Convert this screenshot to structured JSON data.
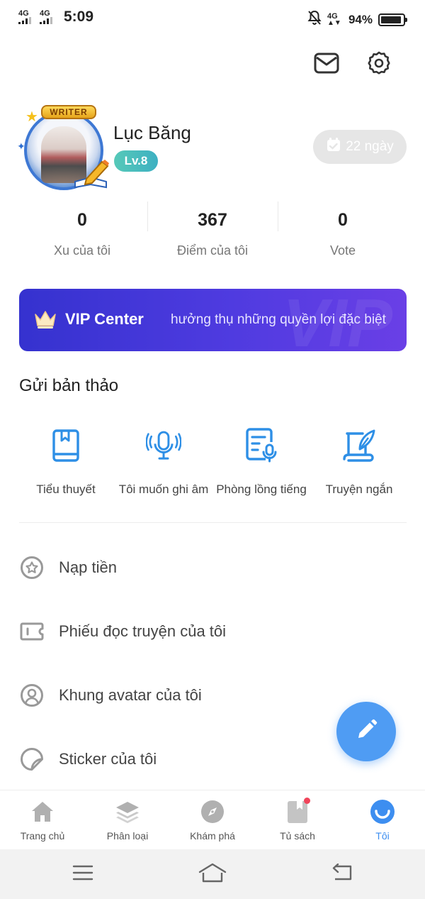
{
  "status_bar": {
    "network_1": "4G",
    "network_2": "4G",
    "time": "5:09",
    "network_3": "4G",
    "battery": "94%",
    "battery_level": 0.94
  },
  "profile": {
    "avatar_badge": "WRITER",
    "name": "Lục Băng",
    "level": "Lv.8",
    "checkin_days": "22 ngày"
  },
  "stats": [
    {
      "value": "0",
      "label": "Xu của tôi"
    },
    {
      "value": "367",
      "label": "Điểm của tôi"
    },
    {
      "value": "0",
      "label": "Vote"
    }
  ],
  "vip": {
    "title": "VIP Center",
    "subtitle": "hưởng thụ những quyền lợi đặc biệt",
    "watermark": "VIP",
    "colors": {
      "from": "#3532cf",
      "to": "#6a3fe6"
    }
  },
  "submission": {
    "title": "Gửi bản thảo",
    "items": [
      {
        "label": "Tiểu thuyết",
        "icon": "book-icon"
      },
      {
        "label": "Tôi muốn ghi âm",
        "icon": "microphone-icon"
      },
      {
        "label": "Phòng lồng tiếng",
        "icon": "dubbing-room-icon"
      },
      {
        "label": "Truyện ngắn",
        "icon": "quill-icon"
      }
    ]
  },
  "menu": [
    {
      "label": "Nạp tiền",
      "icon": "star-circle-icon"
    },
    {
      "label": "Phiếu đọc truyện của tôi",
      "icon": "ticket-icon"
    },
    {
      "label": "Khung avatar của tôi",
      "icon": "avatar-frame-icon"
    },
    {
      "label": "Sticker của tôi",
      "icon": "sticker-icon"
    }
  ],
  "tabs": [
    {
      "label": "Trang chủ",
      "icon": "home-icon",
      "active": false
    },
    {
      "label": "Phân loại",
      "icon": "layers-icon",
      "active": false
    },
    {
      "label": "Khám phá",
      "icon": "compass-icon",
      "active": false
    },
    {
      "label": "Tủ sách",
      "icon": "bookshelf-icon",
      "active": false,
      "has_dot": true
    },
    {
      "label": "Tôi",
      "icon": "smile-icon",
      "active": true
    }
  ],
  "colors": {
    "accent": "#3d8ef0",
    "fab": "#4f9cf3",
    "level_badge": "#4bbfbb",
    "icon_blue": "#2e8fe6"
  }
}
